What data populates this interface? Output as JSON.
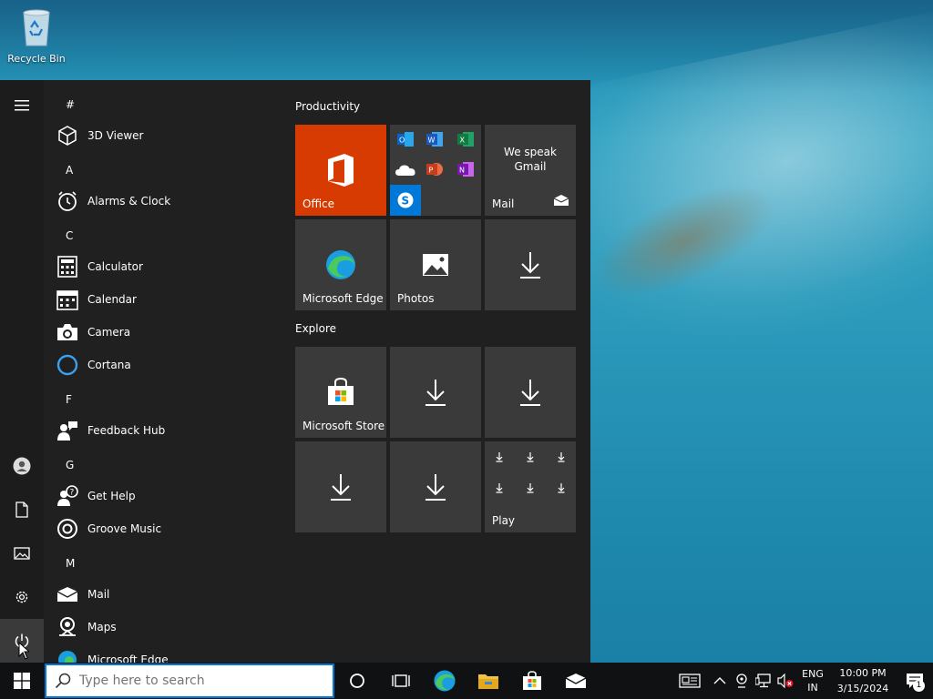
{
  "desktop": {
    "icons": [
      {
        "label": "Recycle Bin",
        "icon": "recycle-bin-icon"
      }
    ]
  },
  "start_menu": {
    "rail": [
      {
        "name": "menu",
        "icon": "hamburger-icon"
      },
      {
        "name": "account",
        "icon": "user-icon"
      },
      {
        "name": "documents",
        "icon": "document-icon"
      },
      {
        "name": "pictures",
        "icon": "picture-icon"
      },
      {
        "name": "settings",
        "icon": "gear-icon"
      },
      {
        "name": "power",
        "icon": "power-icon"
      }
    ],
    "groups": {
      "hash": "#",
      "a": "A",
      "c": "C",
      "f": "F",
      "g": "G",
      "m": "M"
    },
    "apps": {
      "viewer3d": "3D Viewer",
      "alarms": "Alarms & Clock",
      "calculator": "Calculator",
      "calendar": "Calendar",
      "camera": "Camera",
      "cortana": "Cortana",
      "feedback": "Feedback Hub",
      "gethelp": "Get Help",
      "groove": "Groove Music",
      "mail": "Mail",
      "maps": "Maps",
      "edge": "Microsoft Edge"
    },
    "sections": {
      "productivity": "Productivity",
      "explore": "Explore"
    },
    "tiles": {
      "office": "Office",
      "mail_line1": "We speak",
      "mail_line2": "Gmail",
      "mail": "Mail",
      "edge": "Microsoft Edge",
      "photos": "Photos",
      "store": "Microsoft Store",
      "play": "Play"
    },
    "colors": {
      "office_tile": "#d83b01",
      "skype": "#0078d7",
      "tile_bg": "#3a3a3a",
      "menu_bg": "#202020"
    }
  },
  "taskbar": {
    "search_placeholder": "Type here to search",
    "language_line1": "ENG",
    "language_line2": "IN",
    "time": "10:00 PM",
    "date": "3/15/2024",
    "notification_count": "1"
  }
}
